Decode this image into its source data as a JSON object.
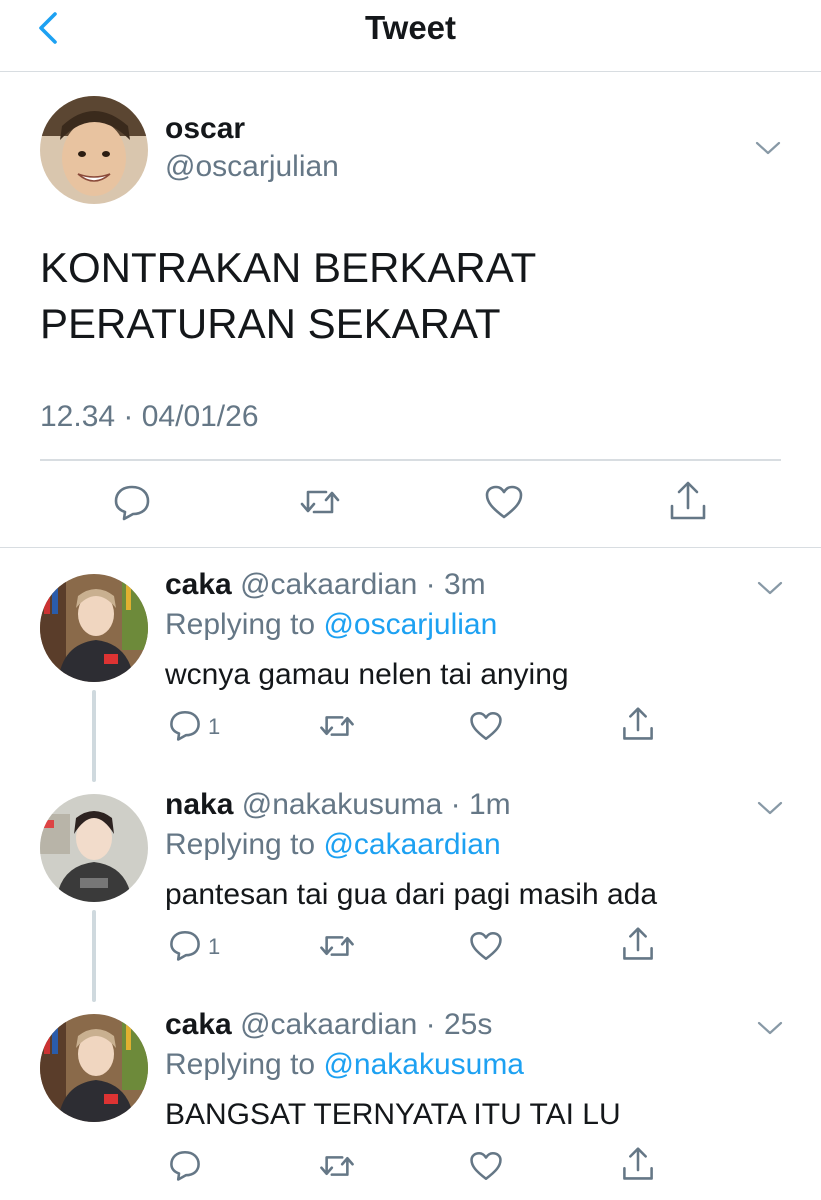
{
  "header": {
    "title": "Tweet"
  },
  "tweet": {
    "name": "oscar",
    "handle": "@oscarjulian",
    "text": "KONTRAKAN BERKARAT\nPERATURAN SEKARAT",
    "timestamp": "12.34 · 04/01/26"
  },
  "replies": [
    {
      "name": "caka",
      "meta": "@cakaardian · 3m",
      "replying_prefix": "Replying to ",
      "replying_to": "@oscarjulian",
      "text": "wcnya gamau nelen tai anying",
      "reply_count": "1"
    },
    {
      "name": "naka",
      "meta": "@nakakusuma · 1m",
      "replying_prefix": "Replying to ",
      "replying_to": "@cakaardian",
      "text": "pantesan tai gua dari pagi masih ada",
      "reply_count": "1"
    },
    {
      "name": "caka",
      "meta": "@cakaardian · 25s",
      "replying_prefix": "Replying to ",
      "replying_to": "@nakakusuma",
      "text": "BANGSAT TERNYATA ITU TAI LU",
      "reply_count": ""
    }
  ],
  "icons": {
    "back": "chevron-left-icon",
    "menu": "chevron-down-icon",
    "reply": "speech-bubble-icon",
    "retweet": "retweet-icon",
    "like": "heart-icon",
    "share": "share-icon"
  },
  "colors": {
    "accent": "#1da1f2",
    "secondary_text": "#657786",
    "divider": "#d8dde1"
  }
}
